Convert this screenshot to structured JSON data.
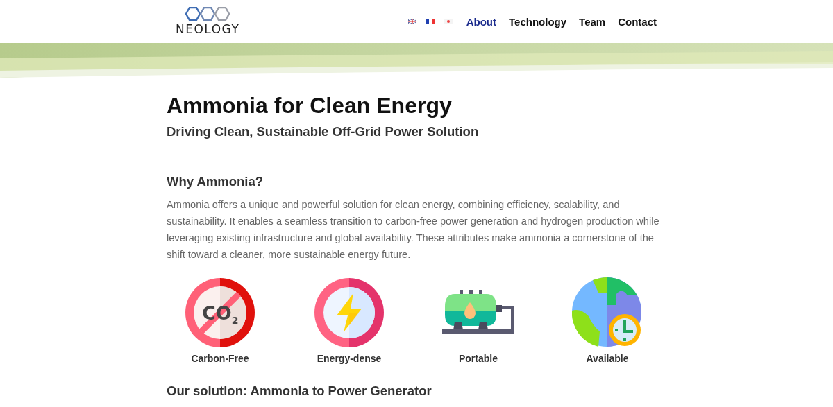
{
  "header": {
    "logo_text": "NEOLOGY",
    "nav": [
      {
        "label": "About",
        "selected": true
      },
      {
        "label": "Technology",
        "selected": false
      },
      {
        "label": "Team",
        "selected": false
      },
      {
        "label": "Contact",
        "selected": false
      }
    ]
  },
  "title": "Ammonia for Clean Energy",
  "subtitle": "Driving Clean, Sustainable Off-Grid Power Solution",
  "section": {
    "heading": "Why Ammonia?",
    "text": "Ammonia offers a unique and powerful solution for clean energy, combining efficiency, scalability, and sustainability. It enables a seamless transition to carbon-free power generation and hydrogen production while leveraging existing infrastructure and global availability. These attributes make ammonia a cornerstone of the shift toward a cleaner, more sustainable energy future."
  },
  "features": [
    {
      "kind": "co2",
      "label": "Carbon-Free",
      "icon_text": "CO",
      "icon_sub": "2"
    },
    {
      "kind": "bolt",
      "label": "Energy-dense"
    },
    {
      "kind": "tank",
      "label": "Portable"
    },
    {
      "kind": "globe",
      "label": "Available"
    }
  ],
  "next_heading": "Our solution: Ammonia to Power Generator"
}
